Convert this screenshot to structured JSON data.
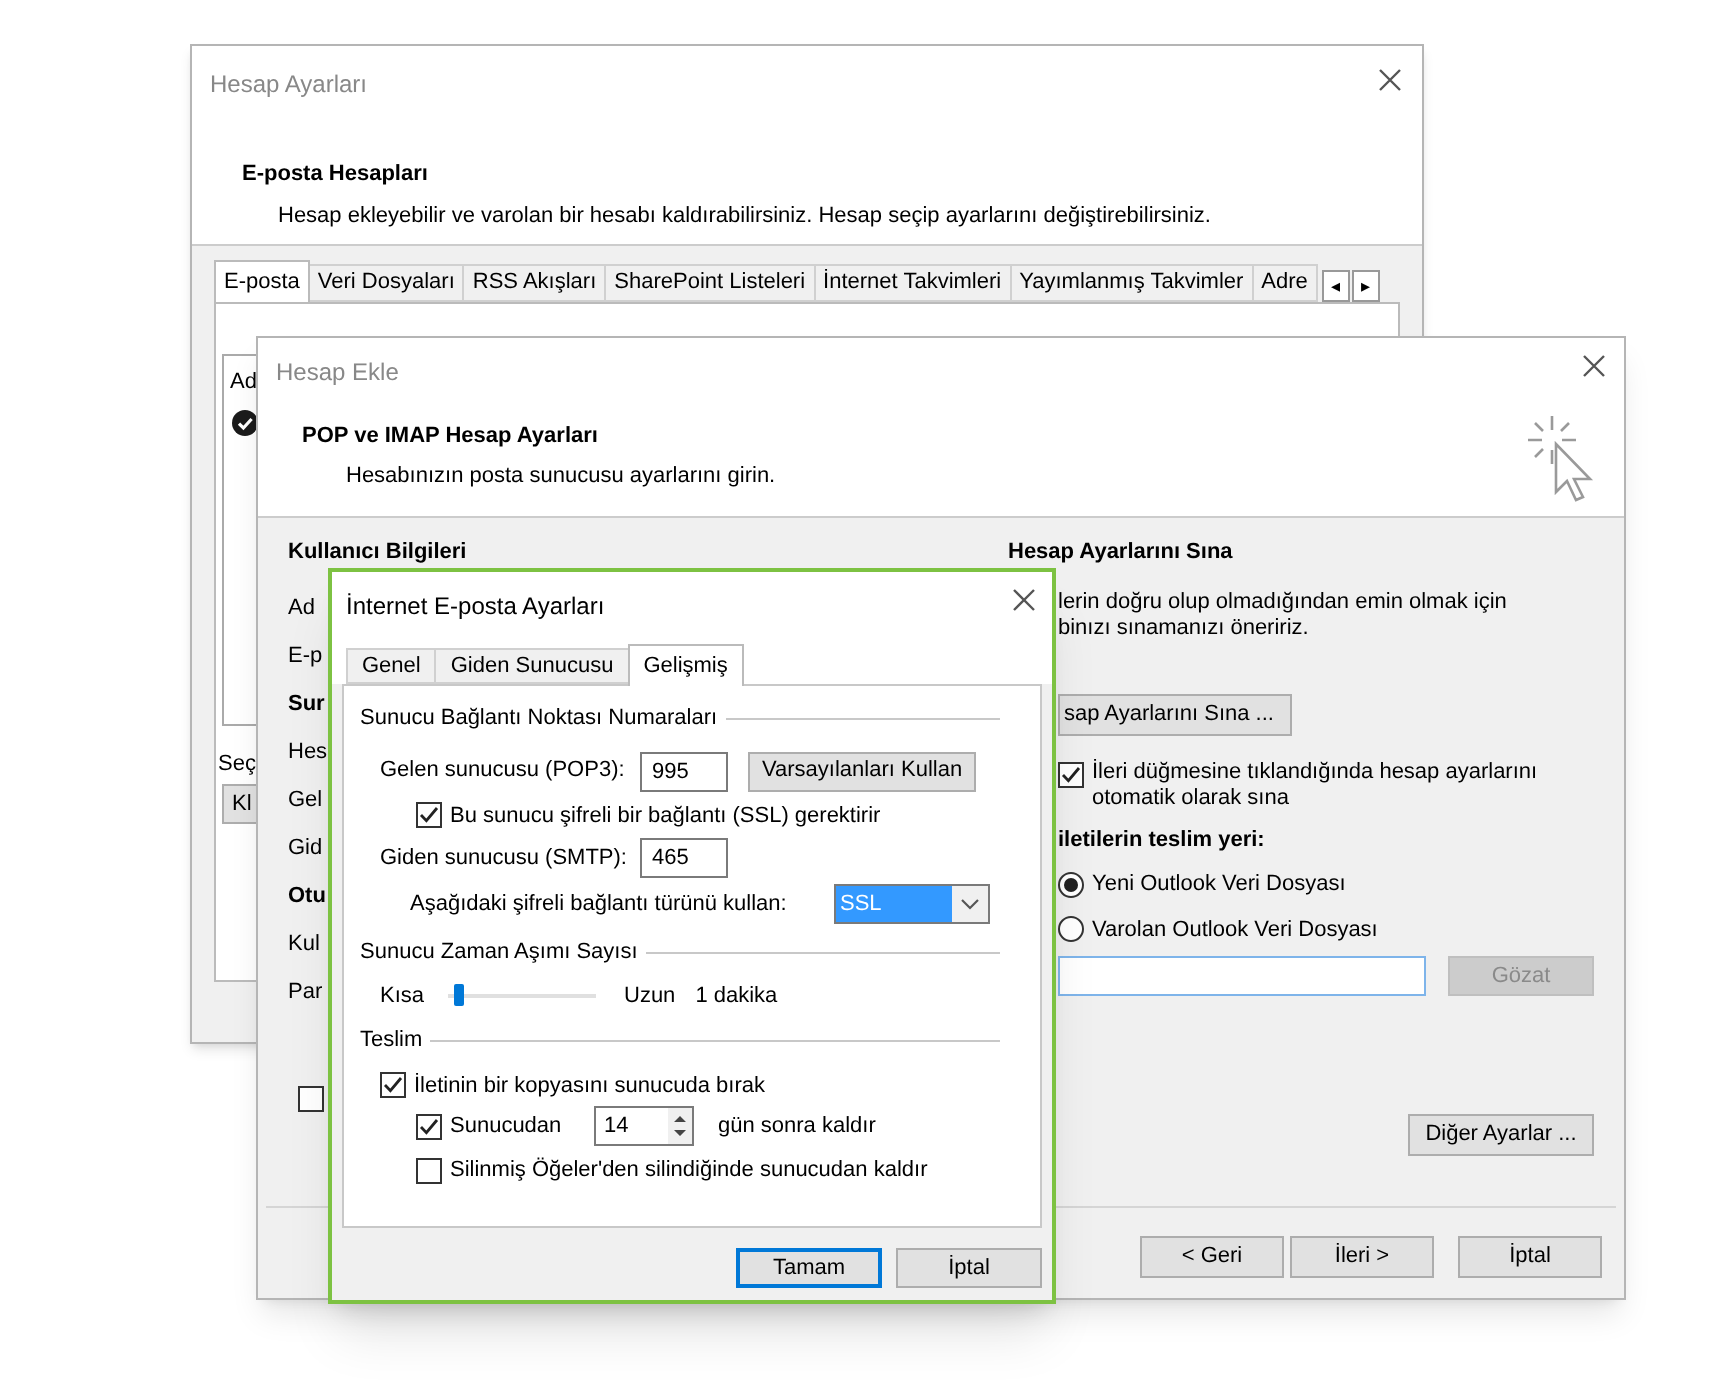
{
  "hesap_ayarlari": {
    "title": "Hesap Ayarları",
    "heading": "E-posta Hesapları",
    "description": "Hesap ekleyebilir ve varolan bir hesabı kaldırabilirsiniz. Hesap seçip ayarlarını değiştirebilirsiniz.",
    "tabs": [
      {
        "label": "E-posta",
        "selected": true
      },
      {
        "label": "Veri Dosyaları",
        "selected": false
      },
      {
        "label": "RSS Akışları",
        "selected": false
      },
      {
        "label": "SharePoint Listeleri",
        "selected": false
      },
      {
        "label": "İnternet Takvimleri",
        "selected": false
      },
      {
        "label": "Yayımlanmış Takvimler",
        "selected": false
      },
      {
        "label": "Adre",
        "selected": false
      }
    ],
    "tab_scroll": [
      "◂",
      "▸"
    ],
    "list_column": "Ad",
    "label_fragment": "Seç",
    "button_fragment": "Kl"
  },
  "hesap_ekle": {
    "title": "Hesap Ekle",
    "heading": "POP ve IMAP Hesap Ayarları",
    "description": "Hesabınızın posta sunucusu ayarlarını girin.",
    "user_section": "Kullanıcı Bilgileri",
    "left_fragments": [
      {
        "text": "Ad",
        "kind": "label"
      },
      {
        "text": "E-p",
        "kind": "label"
      },
      {
        "text": "Sur",
        "kind": "heading"
      },
      {
        "text": "Hes",
        "kind": "label"
      },
      {
        "text": "Gel",
        "kind": "label"
      },
      {
        "text": "Gid",
        "kind": "label"
      },
      {
        "text": "Otu",
        "kind": "heading"
      },
      {
        "text": "Kul",
        "kind": "label"
      },
      {
        "text": "Par",
        "kind": "label"
      }
    ],
    "left_checkbox": {
      "checked": false
    },
    "test_section": {
      "heading": "Hesap Ayarlarını Sına",
      "lines": [
        "lerin doğru olup olmadığından emin olmak için",
        "binızı sınamanızı öneririz."
      ],
      "button": "sap Ayarlarını Sına ...",
      "auto_test": {
        "label": "İleri düğmesine tıklandığında hesap ayarlarını otomatik olarak sına",
        "checked": true
      },
      "delivery_heading": "iletilerin teslim yeri:",
      "delivery_options": [
        {
          "label": "Yeni Outlook Veri Dosyası",
          "selected": true
        },
        {
          "label": "Varolan Outlook Veri Dosyası",
          "selected": false
        }
      ],
      "browse_button": {
        "label": "Gözat",
        "disabled": true
      },
      "more_button": "Diğer Ayarlar ..."
    },
    "nav_buttons": [
      "< Geri",
      "İleri >",
      "İptal"
    ]
  },
  "internet_eposta": {
    "title": "İnternet E-posta Ayarları",
    "tabs": [
      {
        "label": "Genel",
        "selected": false
      },
      {
        "label": "Giden Sunucusu",
        "selected": false
      },
      {
        "label": "Gelişmiş",
        "selected": true
      }
    ],
    "ports": {
      "heading": "Sunucu Bağlantı Noktası Numaraları",
      "incoming_label": "Gelen sunucusu (POP3):",
      "incoming_value": "995",
      "defaults_button": "Varsayılanları Kullan",
      "ssl_required": {
        "label": "Bu sunucu şifreli bir bağlantı (SSL) gerektirir",
        "checked": true
      },
      "outgoing_label": "Giden sunucusu (SMTP):",
      "outgoing_value": "465",
      "encryption_label": "Aşağıdaki şifreli bağlantı türünü kullan:",
      "encryption_value": "SSL"
    },
    "timeout": {
      "heading": "Sunucu Zaman Aşımı Sayısı",
      "min_label": "Kısa",
      "max_label": "Uzun",
      "level": 0.05,
      "reading": "1 dakika"
    },
    "delivery": {
      "heading": "Teslim",
      "leave_copy": {
        "label": "İletinin bir kopyasını sunucuda bırak",
        "checked": true
      },
      "remove_after": {
        "label": "Sunucudan",
        "checked": true,
        "days": "14",
        "suffix": "gün sonra kaldır"
      },
      "remove_deleted": {
        "label": "Silinmiş Öğeler'den silindiğinde sunucudan kaldır",
        "checked": false
      }
    },
    "buttons": [
      {
        "label": "Tamam",
        "default": true
      },
      {
        "label": "İptal",
        "default": false
      }
    ]
  }
}
